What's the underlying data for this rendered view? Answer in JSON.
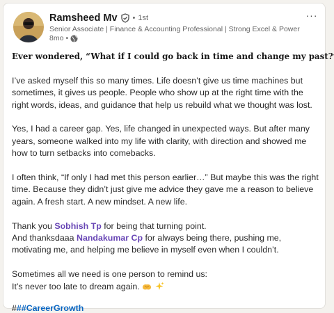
{
  "post": {
    "author": {
      "name": "Ramsheed Mv",
      "degree": "1st",
      "headline": "Senior Associate | Finance & Accounting Professional | Strong Excel & Power ...",
      "time": "8mo",
      "verified_icon": "verified-shield-icon",
      "visibility_icon": "globe-icon",
      "dot": "•"
    },
    "menu_label": "···",
    "lead": "Ever wondered, “What if I could go back in time and change my past?”",
    "p1": "I’ve asked myself this so many times. Life doesn’t give us time machines but sometimes, it gives us people. People who show up at the right time with the right words, ideas, and guidance that help us rebuild what we thought was lost.",
    "p2": "Yes, I had a career gap. Yes, life changed in unexpected ways. But after many years, someone walked into my life with clarity, with direction and showed me how to turn setbacks into comebacks.",
    "p3": "I often think, “If only I had met this person earlier…” But maybe this was the right time. Because they didn’t just give me advice they gave me a reason to believe again. A fresh start. A new mindset. A new life.",
    "p4": {
      "a1": "Thank you ",
      "mention1": "Sobhish Tp",
      "a2": " for being that turning point.",
      "b1": "And thanksdaaa ",
      "mention2": "Nandakumar Cp",
      "b2": " for always being there, pushing me, motivating me, and helping me believe in myself even when I couldn’t."
    },
    "p5": {
      "line1": "Sometimes all we need is one person to remind us:",
      "line2": "It’s never too late to dream again. "
    },
    "emojis": [
      "hands-emoji",
      "sparkles-emoji"
    ],
    "hashtags": {
      "prefix": "#",
      "h1": "#",
      "h2": "#CareerGrowth"
    }
  }
}
